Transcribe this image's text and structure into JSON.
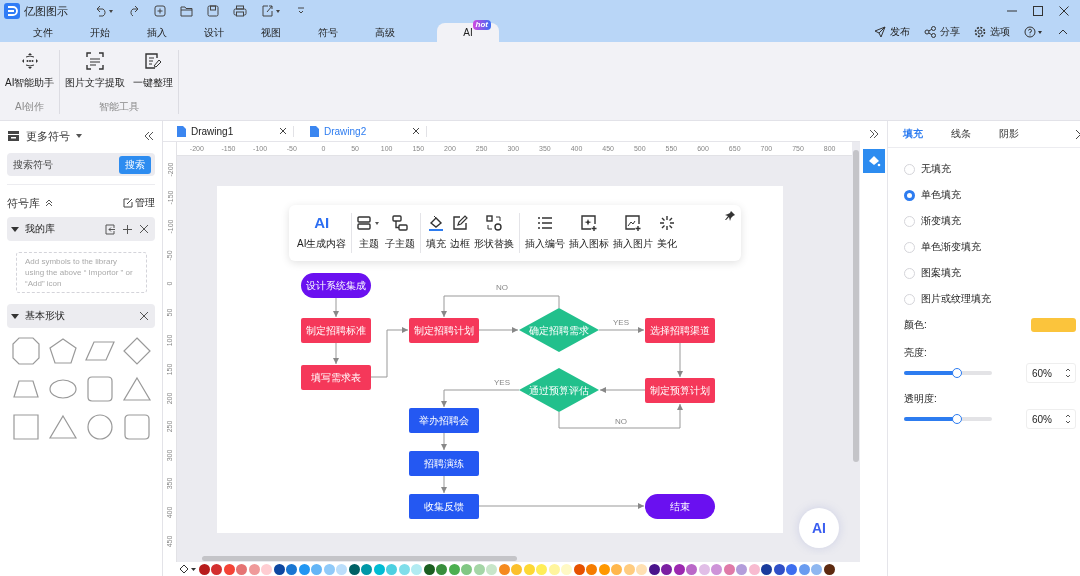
{
  "app": {
    "title": "亿图图示"
  },
  "menu_tabs": [
    {
      "label": "文件",
      "selected": false
    },
    {
      "label": "开始",
      "selected": false
    },
    {
      "label": "插入",
      "selected": false
    },
    {
      "label": "设计",
      "selected": false
    },
    {
      "label": "视图",
      "selected": false
    },
    {
      "label": "符号",
      "selected": false
    },
    {
      "label": "高级",
      "selected": false
    },
    {
      "label": "AI",
      "selected": true,
      "badge": "hot"
    }
  ],
  "header_actions": [
    {
      "label": "发布",
      "kind": "publish"
    },
    {
      "label": "分享",
      "kind": "share"
    },
    {
      "label": "选项",
      "kind": "options"
    }
  ],
  "ribbon": {
    "groups": [
      {
        "title": "AI创作",
        "items": [
          {
            "label": "AI智能助手",
            "kind": "assistant"
          }
        ]
      },
      {
        "title": "智能工具",
        "items": [
          {
            "label": "图片文字提取",
            "kind": "ocr"
          },
          {
            "label": "一键整理",
            "kind": "tidy"
          }
        ]
      }
    ]
  },
  "left_panel": {
    "title": "更多符号",
    "search": {
      "placeholder": "搜索符号",
      "button": "搜索"
    },
    "library": {
      "title": "符号库",
      "manage": "管理"
    },
    "my_library": {
      "title": "我的库",
      "expanded": true,
      "hint": "Add symbols to the library using the above “ Importor ” or  “Add” icon"
    },
    "basic_shapes": {
      "title": "基本形状",
      "expanded": true,
      "shapes": [
        {
          "kind": "octagon"
        },
        {
          "kind": "pentagon"
        },
        {
          "kind": "parallelogram"
        },
        {
          "kind": "diamond"
        },
        {
          "kind": "trapezoid"
        },
        {
          "kind": "ellipse"
        },
        {
          "kind": "rounded-square"
        },
        {
          "kind": "triangle"
        },
        {
          "kind": "square"
        },
        {
          "kind": "triangle"
        },
        {
          "kind": "circle"
        },
        {
          "kind": "rounded-square"
        }
      ]
    }
  },
  "doc_tabs": [
    {
      "label": "Drawing1",
      "selected": false
    },
    {
      "label": "Drawing2",
      "selected": true
    }
  ],
  "rulers": {
    "horizontal": [
      "-200",
      "-150",
      "-100",
      "-50",
      "0",
      "50",
      "100",
      "150",
      "200",
      "250",
      "300",
      "350",
      "400",
      "450",
      "500",
      "550",
      "600",
      "650",
      "700",
      "750",
      "800"
    ],
    "vertical": [
      "-200",
      "-150",
      "-100",
      "-50",
      "0",
      "50",
      "100",
      "150",
      "200",
      "250",
      "300",
      "350",
      "400",
      "450"
    ]
  },
  "floating_toolbar": {
    "groups": [
      [
        {
          "label": "AI生成内容",
          "kind": "ai",
          "glyph": "AI"
        }
      ],
      [
        {
          "label": "主题",
          "kind": "topic"
        },
        {
          "label": "子主题",
          "kind": "subtopic"
        }
      ],
      [
        {
          "label": "填充",
          "kind": "fill"
        },
        {
          "label": "边框",
          "kind": "border"
        },
        {
          "label": "形状替换",
          "kind": "shape"
        }
      ],
      [
        {
          "label": "插入编号",
          "kind": "numbering"
        },
        {
          "label": "插入图标",
          "kind": "icon"
        },
        {
          "label": "插入图片",
          "kind": "image"
        },
        {
          "label": "美化",
          "kind": "beautify"
        }
      ]
    ]
  },
  "flowchart": {
    "nodes": [
      {
        "label": "设计系统集成",
        "kind": "terminal",
        "color": "#6a10f0"
      },
      {
        "label": "制定招聘标准",
        "kind": "process",
        "color": "#f5385a"
      },
      {
        "label": "填写需求表",
        "kind": "process",
        "color": "#f5385a"
      },
      {
        "label": "制定招聘计划",
        "kind": "process",
        "color": "#f5385a"
      },
      {
        "label": "确定招聘需求",
        "kind": "decision",
        "color": "#22c08c"
      },
      {
        "label": "选择招聘渠道",
        "kind": "process",
        "color": "#f5385a"
      },
      {
        "label": "通过预算评估",
        "kind": "decision",
        "color": "#22c08c"
      },
      {
        "label": "制定预算计划",
        "kind": "process",
        "color": "#f5385a"
      },
      {
        "label": "举办招聘会",
        "kind": "process",
        "color": "#2458f2"
      },
      {
        "label": "招聘演练",
        "kind": "process",
        "color": "#2458f2"
      },
      {
        "label": "收集反馈",
        "kind": "process",
        "color": "#2458f2"
      },
      {
        "label": "结束",
        "kind": "terminal",
        "color": "#6a10f0"
      }
    ],
    "edge_labels": [
      "NO",
      "YES",
      "YES",
      "NO"
    ]
  },
  "ai_button": {
    "label": "AI"
  },
  "right_panel": {
    "tabs": [
      {
        "label": "填充",
        "selected": true
      },
      {
        "label": "线条",
        "selected": false
      },
      {
        "label": "阴影",
        "selected": false
      }
    ],
    "fill_options": [
      {
        "label": "无填充",
        "selected": false
      },
      {
        "label": "单色填充",
        "selected": true
      },
      {
        "label": "渐变填充",
        "selected": false
      },
      {
        "label": "单色渐变填充",
        "selected": false
      },
      {
        "label": "图案填充",
        "selected": false
      },
      {
        "label": "图片或纹理填充",
        "selected": false
      }
    ],
    "color": {
      "label": "颜色:",
      "color": "#fbc43c"
    },
    "sliders": [
      {
        "label": "亮度:",
        "level": 0.6,
        "reading": "60%"
      },
      {
        "label": "透明度:",
        "level": 0.6,
        "reading": "60%"
      }
    ]
  },
  "palette": {
    "colors": [
      {
        "color": "#b71c1c"
      },
      {
        "color": "#d32f2f"
      },
      {
        "color": "#f44336"
      },
      {
        "color": "#e57373"
      },
      {
        "color": "#ef9a9a"
      },
      {
        "color": "#ffcdd2"
      },
      {
        "color": "#0d47a1"
      },
      {
        "color": "#1976d2"
      },
      {
        "color": "#2196f3"
      },
      {
        "color": "#64b5f6"
      },
      {
        "color": "#90caf9"
      },
      {
        "color": "#bbdefb"
      },
      {
        "color": "#006064"
      },
      {
        "color": "#0097a7"
      },
      {
        "color": "#00bcd4"
      },
      {
        "color": "#4dd0e1"
      },
      {
        "color": "#80deea"
      },
      {
        "color": "#b2ebf2"
      },
      {
        "color": "#1b5e20"
      },
      {
        "color": "#388e3c"
      },
      {
        "color": "#4caf50"
      },
      {
        "color": "#81c784"
      },
      {
        "color": "#a5d6a7"
      },
      {
        "color": "#c8e6c9"
      },
      {
        "color": "#f58a1f"
      },
      {
        "color": "#fbc02d"
      },
      {
        "color": "#fdd835"
      },
      {
        "color": "#ffee58"
      },
      {
        "color": "#fff59d"
      },
      {
        "color": "#fff9c4"
      },
      {
        "color": "#e65100"
      },
      {
        "color": "#f57c00"
      },
      {
        "color": "#ff9800"
      },
      {
        "color": "#ffb74d"
      },
      {
        "color": "#ffcc80"
      },
      {
        "color": "#ffe0b2"
      },
      {
        "color": "#4a148c"
      },
      {
        "color": "#7b1fa2"
      },
      {
        "color": "#9c27b0"
      },
      {
        "color": "#ba68c8"
      },
      {
        "color": "#e1bee7"
      },
      {
        "color": "#ce93d8"
      },
      {
        "color": "#e07aa8"
      },
      {
        "color": "#b39ddb"
      },
      {
        "color": "#f8bbd0"
      },
      {
        "color": "#1a3b9c"
      },
      {
        "color": "#2f4fc7"
      },
      {
        "color": "#3d6ef0"
      },
      {
        "color": "#6a9cf0"
      },
      {
        "color": "#8fb7f0"
      },
      {
        "color": "#5d2a10"
      }
    ]
  }
}
